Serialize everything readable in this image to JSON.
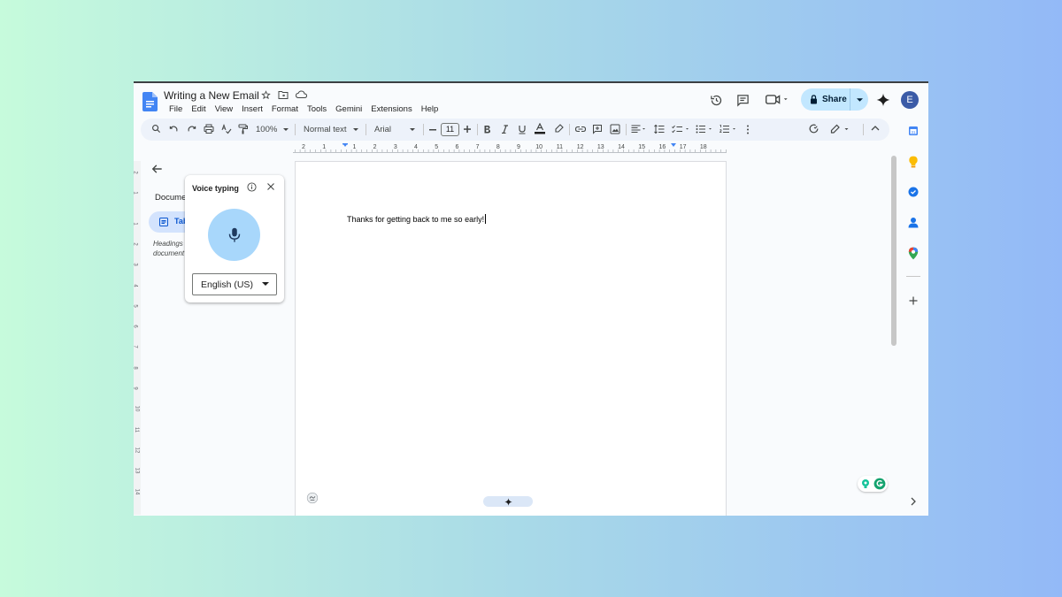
{
  "document": {
    "title": "Writing a New Email",
    "body_text": "Thanks for getting back to me so early!"
  },
  "menu": [
    "File",
    "Edit",
    "View",
    "Insert",
    "Format",
    "Tools",
    "Gemini",
    "Extensions",
    "Help"
  ],
  "header": {
    "share_label": "Share",
    "avatar_letter": "E"
  },
  "toolbar": {
    "zoom": "100%",
    "style": "Normal text",
    "font": "Arial",
    "font_size": "11"
  },
  "ruler": {
    "labels": [
      "2",
      "1",
      "1",
      "2",
      "3",
      "4",
      "5",
      "6",
      "7",
      "8",
      "9",
      "10",
      "11",
      "12",
      "13",
      "14",
      "15",
      "16",
      "17",
      "18"
    ]
  },
  "vertical_ruler": {
    "labels": [
      "2",
      "1",
      "1",
      "2",
      "3",
      "4",
      "5",
      "6",
      "7",
      "8",
      "9",
      "10",
      "11",
      "12",
      "13",
      "14"
    ]
  },
  "outline": {
    "title_partial": "Docume",
    "tab_label": "Tab",
    "hint_line1": "Headings",
    "hint_line2": "document"
  },
  "voice_typing": {
    "title": "Voice typing",
    "language": "English (US)"
  },
  "colors": {
    "accent": "#0b57d0",
    "share_bg": "#c2e7ff",
    "mic_bg": "#a8d7fb",
    "toolbar_bg": "#edf2fa"
  }
}
